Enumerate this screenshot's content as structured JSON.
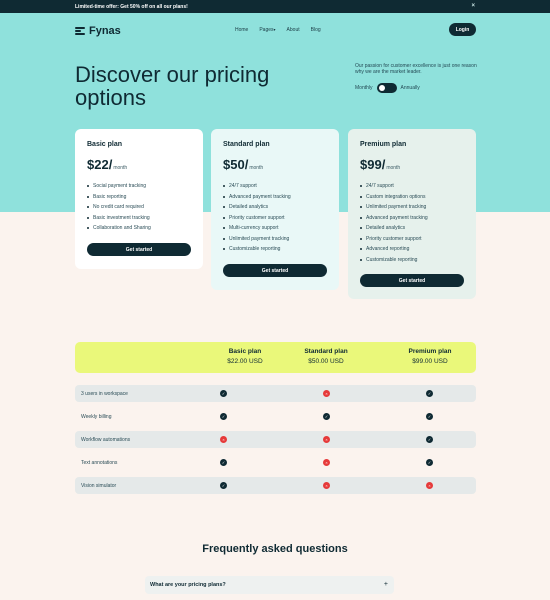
{
  "promo": {
    "text": "Limited-time offer: Get 50% off on all our plans!",
    "close_icon": "×"
  },
  "nav": {
    "brand": "Fynas",
    "links": [
      "Home",
      "Pages",
      "About",
      "Blog"
    ],
    "login": "Login"
  },
  "hero": {
    "title": "Discover our pricing options",
    "tagline": "Our passion for customer excellence is just one reason why we are the market leader.",
    "billing_left": "Monthly",
    "billing_right": "Annually"
  },
  "plans": [
    {
      "name": "Basic plan",
      "price": "$22/",
      "period": "month",
      "features": [
        "Social payment tracking",
        "Basic reporting",
        "No credit card required",
        "Basic investment tracking",
        "Collaboration and Sharing"
      ],
      "cta": "Get started"
    },
    {
      "name": "Standard plan",
      "price": "$50/",
      "period": "month",
      "features": [
        "24/7 support",
        "Advanced payment tracking",
        "Detailed analytics",
        "Priority customer support",
        "Multi-currency support",
        "Unlimited payment tracking",
        "Customizable reporting"
      ],
      "cta": "Get started"
    },
    {
      "name": "Premium plan",
      "price": "$99/",
      "period": "month",
      "features": [
        "24/7 support",
        "Custom integration options",
        "Unlimited payment tracking",
        "Advanced payment tracking",
        "Detailed analytics",
        "Priority customer support",
        "Advanced reporting",
        "Customizable reporting"
      ],
      "cta": "Get started"
    }
  ],
  "comparison": {
    "columns": [
      {
        "name": "Basic plan",
        "price": "$22.00 USD"
      },
      {
        "name": "Standard plan",
        "price": "$50.00 USD"
      },
      {
        "name": "Premium plan",
        "price": "$99.00 USD"
      }
    ],
    "rows": [
      {
        "feature": "3 users in workspace",
        "values": [
          true,
          false,
          true
        ]
      },
      {
        "feature": "Weekly billing",
        "values": [
          true,
          true,
          true
        ]
      },
      {
        "feature": "Workflow automations",
        "values": [
          false,
          false,
          true
        ]
      },
      {
        "feature": "Text annotations",
        "values": [
          true,
          false,
          true
        ]
      },
      {
        "feature": "Vision simulator",
        "values": [
          true,
          false,
          false
        ]
      }
    ],
    "yes_icon": "check-icon",
    "no_icon": "cross-icon"
  },
  "faq": {
    "title": "Frequently asked questions",
    "items": [
      {
        "question": "What are your pricing plans?",
        "toggle": "+"
      }
    ]
  },
  "colors": {
    "hero": "#8fe1dc",
    "accent": "#eaf87a",
    "dark": "#0f2a33",
    "no": "#e63a3a"
  }
}
